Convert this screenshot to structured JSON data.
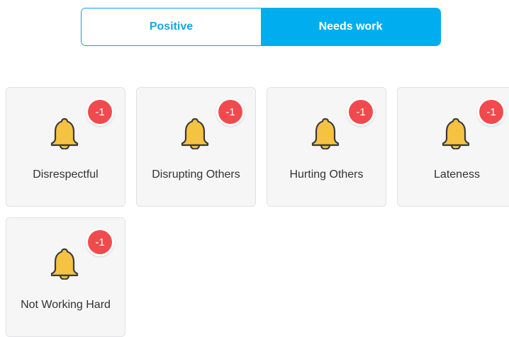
{
  "tabs": {
    "positive_label": "Positive",
    "needs_work_label": "Needs work",
    "selected": "Needs work"
  },
  "colors": {
    "accent": "#00aeef",
    "badge": "#f04a4e",
    "bell": "#f5c242"
  },
  "behaviors": [
    {
      "label": "Disrespectful",
      "points": "-1",
      "icon": "bell-icon"
    },
    {
      "label": "Disrupting Others",
      "points": "-1",
      "icon": "bell-icon"
    },
    {
      "label": "Hurting Others",
      "points": "-1",
      "icon": "bell-icon"
    },
    {
      "label": "Lateness",
      "points": "-1",
      "icon": "bell-icon"
    },
    {
      "label": "Not Working Hard",
      "points": "-1",
      "icon": "bell-icon"
    }
  ]
}
